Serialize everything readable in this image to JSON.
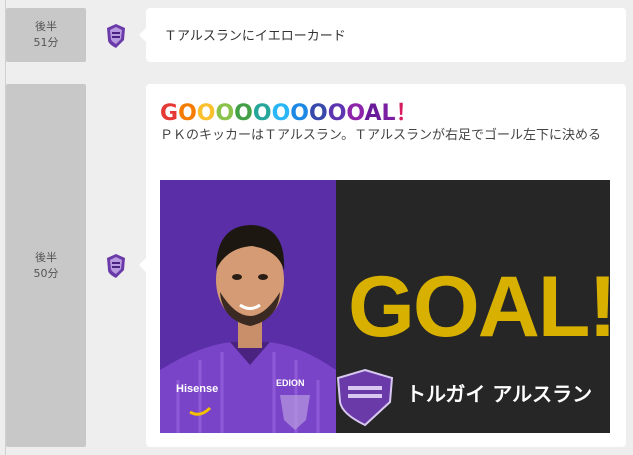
{
  "events": [
    {
      "time_period": "後半",
      "time_minute": "51分",
      "text": "Ｔアルスランにイエローカード"
    },
    {
      "time_period": "後半",
      "time_minute": "50分",
      "goal_title_letters": [
        {
          "ch": "G",
          "color": "#e53935"
        },
        {
          "ch": "O",
          "color": "#f57c00"
        },
        {
          "ch": "O",
          "color": "#fbc02d"
        },
        {
          "ch": "O",
          "color": "#8bc34a"
        },
        {
          "ch": "O",
          "color": "#43a047"
        },
        {
          "ch": "O",
          "color": "#26a69a"
        },
        {
          "ch": "O",
          "color": "#29b6f6"
        },
        {
          "ch": "O",
          "color": "#1e88e5"
        },
        {
          "ch": "O",
          "color": "#3949ab"
        },
        {
          "ch": "O",
          "color": "#5e35b1"
        },
        {
          "ch": "O",
          "color": "#8e24aa"
        },
        {
          "ch": "A",
          "color": "#6a1b9a"
        },
        {
          "ch": "L",
          "color": "#7b1fa2"
        },
        {
          "ch": "！",
          "color": "#d81b60"
        }
      ],
      "description": "ＰＫのキッカーはＴアルスラン。Ｔアルスランが右足でゴール左下に決める",
      "image": {
        "goal_word": "GOAL!",
        "player_name": "トルガイ アルスラン",
        "jersey_sponsor": "Hisense",
        "jersey_sponsor2": "EDION",
        "colors": {
          "purple": "#5a2ea6",
          "dark": "#262626",
          "gold": "#d8b100"
        }
      }
    }
  ],
  "team_emblem_icon": "sanfrecce-emblem-icon"
}
